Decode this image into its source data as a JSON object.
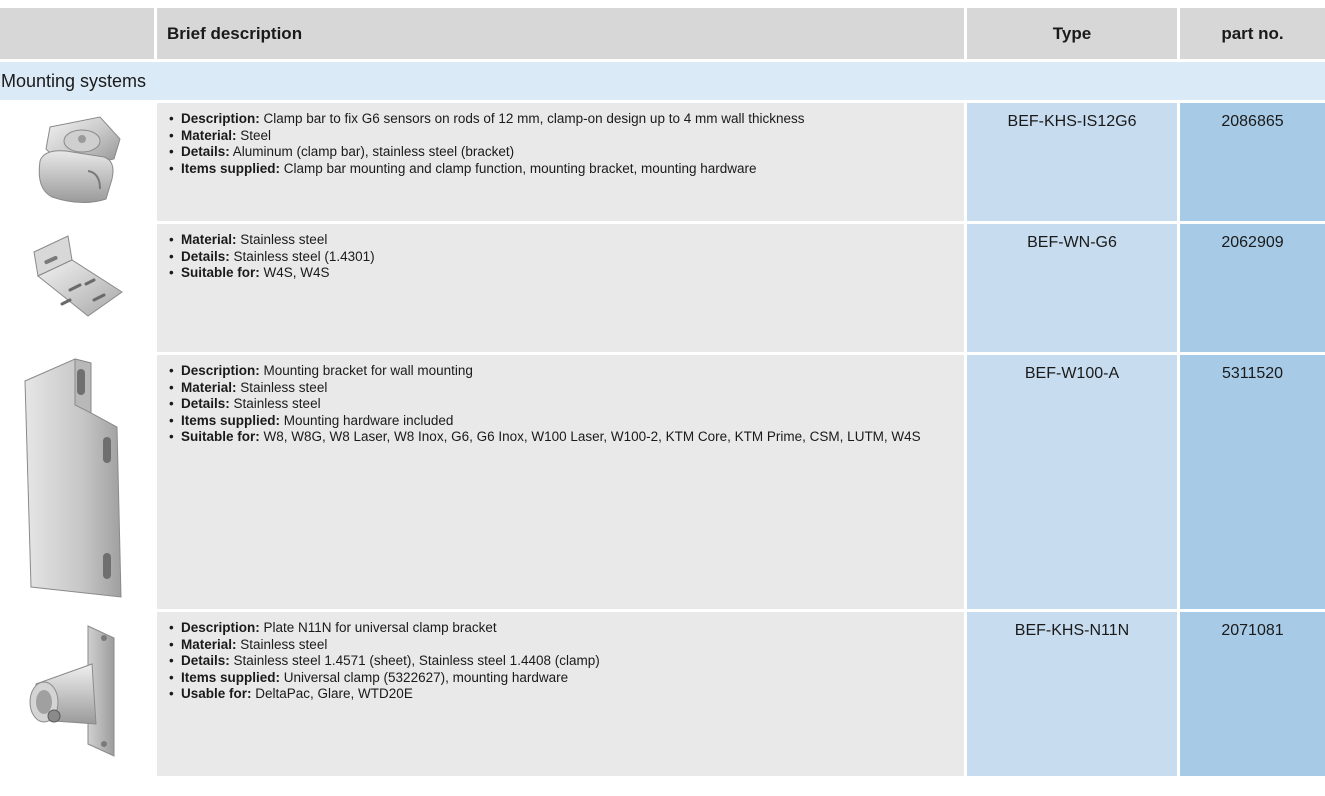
{
  "header": {
    "desc_label": "Brief description",
    "type_label": "Type",
    "part_label": "part no."
  },
  "section": {
    "title": "Mounting systems"
  },
  "products": [
    {
      "image_icon": "clamp-bar-bracket-icon",
      "type": "BEF-KHS-IS12G6",
      "part_no": "2086865",
      "features": [
        {
          "label": "Description:",
          "text": " Clamp bar to fix G6 sensors on rods of 12 mm, clamp-on design up to 4 mm wall thickness"
        },
        {
          "label": "Material:",
          "text": " Steel"
        },
        {
          "label": "Details:",
          "text": " Aluminum (clamp bar), stainless steel (bracket)"
        },
        {
          "label": "Items supplied:",
          "text": " Clamp bar mounting and clamp function, mounting bracket, mounting hardware"
        }
      ]
    },
    {
      "image_icon": "angle-bracket-icon",
      "type": "BEF-WN-G6",
      "part_no": "2062909",
      "features": [
        {
          "label": "Material:",
          "text": " Stainless steel"
        },
        {
          "label": "Details:",
          "text": " Stainless steel (1.4301)"
        },
        {
          "label": "Suitable for:",
          "text": " W4S, W4S"
        }
      ]
    },
    {
      "image_icon": "wall-mounting-plate-icon",
      "type": "BEF-W100-A",
      "part_no": "5311520",
      "features": [
        {
          "label": "Description:",
          "text": " Mounting bracket for wall mounting"
        },
        {
          "label": "Material:",
          "text": " Stainless steel"
        },
        {
          "label": "Details:",
          "text": " Stainless steel"
        },
        {
          "label": "Items supplied:",
          "text": " Mounting hardware included"
        },
        {
          "label": "Suitable for:",
          "text": " W8, W8G, W8 Laser, W8 Inox, G6, G6 Inox, W100 Laser, W100-2, KTM Core, KTM Prime, CSM, LUTM, W4S"
        }
      ]
    },
    {
      "image_icon": "universal-clamp-plate-icon",
      "type": "BEF-KHS-N11N",
      "part_no": "2071081",
      "features": [
        {
          "label": "Description:",
          "text": " Plate N11N for universal clamp bracket"
        },
        {
          "label": "Material:",
          "text": " Stainless steel"
        },
        {
          "label": "Details:",
          "text": " Stainless steel 1.4571 (sheet), Stainless steel 1.4408 (clamp)"
        },
        {
          "label": "Items supplied:",
          "text": " Universal clamp (5322627), mounting hardware"
        },
        {
          "label": "Usable for:",
          "text": " DeltaPac, Glare, WTD20E"
        }
      ]
    }
  ]
}
